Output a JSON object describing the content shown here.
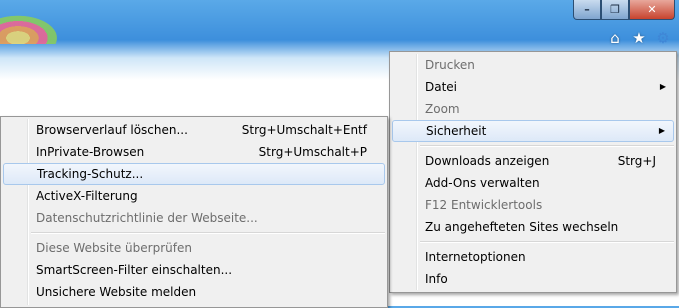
{
  "window_buttons": {
    "minimize": "–",
    "restore": "❐",
    "close": "✕"
  },
  "toolbar": {
    "home": "⌂",
    "favorites": "★",
    "tools": "⚙"
  },
  "main_menu": {
    "printing": "Drucken",
    "file": "Datei",
    "zoom": "Zoom",
    "safety": "Sicherheit",
    "downloads": "Downloads anzeigen",
    "downloads_shortcut": "Strg+J",
    "addons": "Add-Ons verwalten",
    "devtools": "F12 Entwicklertools",
    "pinned": "Zu angehefteten Sites wechseln",
    "internet_options": "Internetoptionen",
    "info": "Info"
  },
  "safety_menu": {
    "delete_history": "Browserverlauf löschen...",
    "delete_history_shortcut": "Strg+Umschalt+Entf",
    "inprivate": "InPrivate-Browsen",
    "inprivate_shortcut": "Strg+Umschalt+P",
    "tracking": "Tracking-Schutz...",
    "activex": "ActiveX-Filterung",
    "privacy_policy": "Datenschutzrichtlinie der Webseite...",
    "check_site": "Diese Website überprüfen",
    "smartscreen": "SmartScreen-Filter einschalten...",
    "report_unsafe": "Unsichere Website melden"
  }
}
